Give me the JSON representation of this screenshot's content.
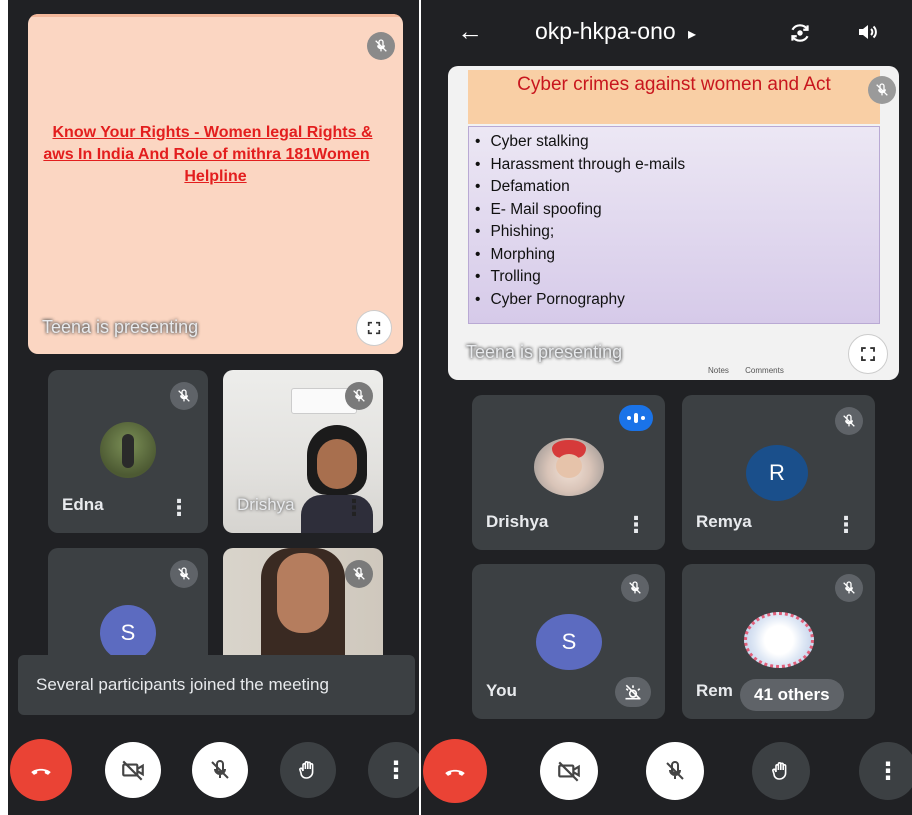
{
  "left": {
    "slide": {
      "title_lines": [
        "Know Your Rights - Women legal Rights &",
        "aws In India  And Role of mithra 181Women",
        "Helpline"
      ]
    },
    "presenting_label": "Teena is presenting",
    "participants": [
      {
        "name": "Edna"
      },
      {
        "name": "Drishya"
      },
      {
        "avatar_letter": "S"
      }
    ],
    "toast": "Several participants joined the meeting"
  },
  "right": {
    "header": {
      "title": "okp-hkpa-ono",
      "caret": "▸"
    },
    "slide": {
      "title": "Cyber crimes against women and Act",
      "bullets": [
        "Cyber stalking",
        "Harassment through e-mails",
        "Defamation",
        "E- Mail spoofing",
        "Phishing;",
        "Morphing",
        "Trolling",
        "Cyber Pornography"
      ],
      "statusbar": {
        "notes": "Notes",
        "comments": "Comments"
      }
    },
    "presenting_label": "Teena is presenting",
    "participants": [
      {
        "name": "Drishya"
      },
      {
        "name": "Remya",
        "avatar_letter": "R"
      },
      {
        "name": "You",
        "avatar_letter": "S"
      },
      {
        "name": "Rem",
        "others_label": "41 others"
      }
    ]
  },
  "colors": {
    "background": "#202124",
    "tile": "#3c4043",
    "end_call": "#ea4335",
    "avatar_blue": "#1a4f8b",
    "avatar_purple": "#5c6bc0",
    "slide_left_bg": "#fbd6c2",
    "slide_right_bg": "#dcd3ec",
    "slide_right_title_bg": "#f9cfa5"
  },
  "icons": [
    "back-arrow-icon",
    "switch-camera-icon",
    "speaker-icon",
    "mic-off-icon",
    "fullscreen-icon",
    "end-call-icon",
    "camera-off-icon",
    "raise-hand-icon",
    "more-vert-icon",
    "speaking-indicator-icon",
    "low-light-icon"
  ]
}
